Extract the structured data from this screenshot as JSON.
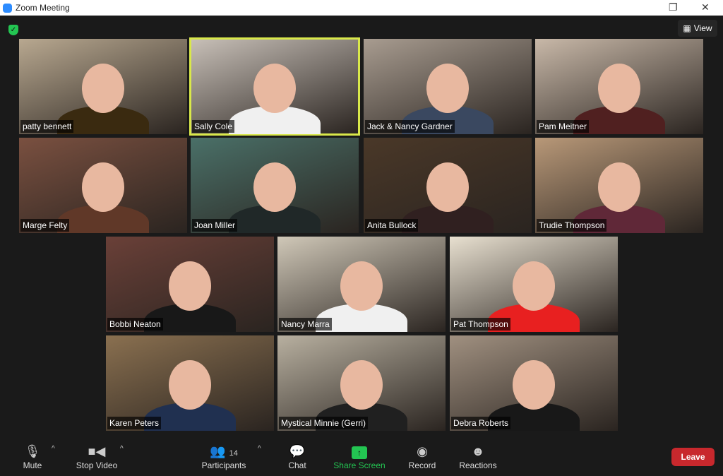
{
  "window": {
    "title": "Zoom Meeting"
  },
  "header": {
    "view_label": "View"
  },
  "participants": [
    {
      "name": "patty bennett",
      "bg": "#b8a890",
      "body": "#3a2a10"
    },
    {
      "name": "Sally Cole",
      "bg": "#c8c0b8",
      "body": "#f0f0f0",
      "active": true
    },
    {
      "name": "Jack & Nancy Gardner",
      "bg": "#a89c90",
      "body": "#3a4860"
    },
    {
      "name": "Pam Meitner",
      "bg": "#c8b8a8",
      "body": "#502020"
    },
    {
      "name": "Marge Felty",
      "bg": "#7a5040",
      "body": "#603828"
    },
    {
      "name": "Joan Miller",
      "bg": "#4a7068",
      "body": "#202828"
    },
    {
      "name": "Anita Bullock",
      "bg": "#4a3828",
      "body": "#302020"
    },
    {
      "name": "Trudie Thompson",
      "bg": "#b89878",
      "body": "#602838"
    },
    {
      "name": "Bobbi Neaton",
      "bg": "#6a4038",
      "body": "#181818"
    },
    {
      "name": "Nancy Marra",
      "bg": "#d0c8b8",
      "body": "#f0f0f0"
    },
    {
      "name": "Pat Thompson",
      "bg": "#e8e0d0",
      "body": "#e82020"
    },
    {
      "name": "Karen Peters",
      "bg": "#8a7050",
      "body": "#203050"
    },
    {
      "name": "Mystical Minnie (Gerri)",
      "bg": "#b8b0a0",
      "body": "#202020"
    },
    {
      "name": "Debra Roberts",
      "bg": "#a09080",
      "body": "#181818"
    }
  ],
  "toolbar": {
    "mute": "Mute",
    "stop_video": "Stop Video",
    "participants": "Participants",
    "participant_count": "14",
    "chat": "Chat",
    "share_screen": "Share Screen",
    "record": "Record",
    "reactions": "Reactions",
    "leave": "Leave"
  },
  "colors": {
    "share": "#23c552",
    "leave": "#c8282d",
    "active_speaker": "#d9e84a"
  }
}
